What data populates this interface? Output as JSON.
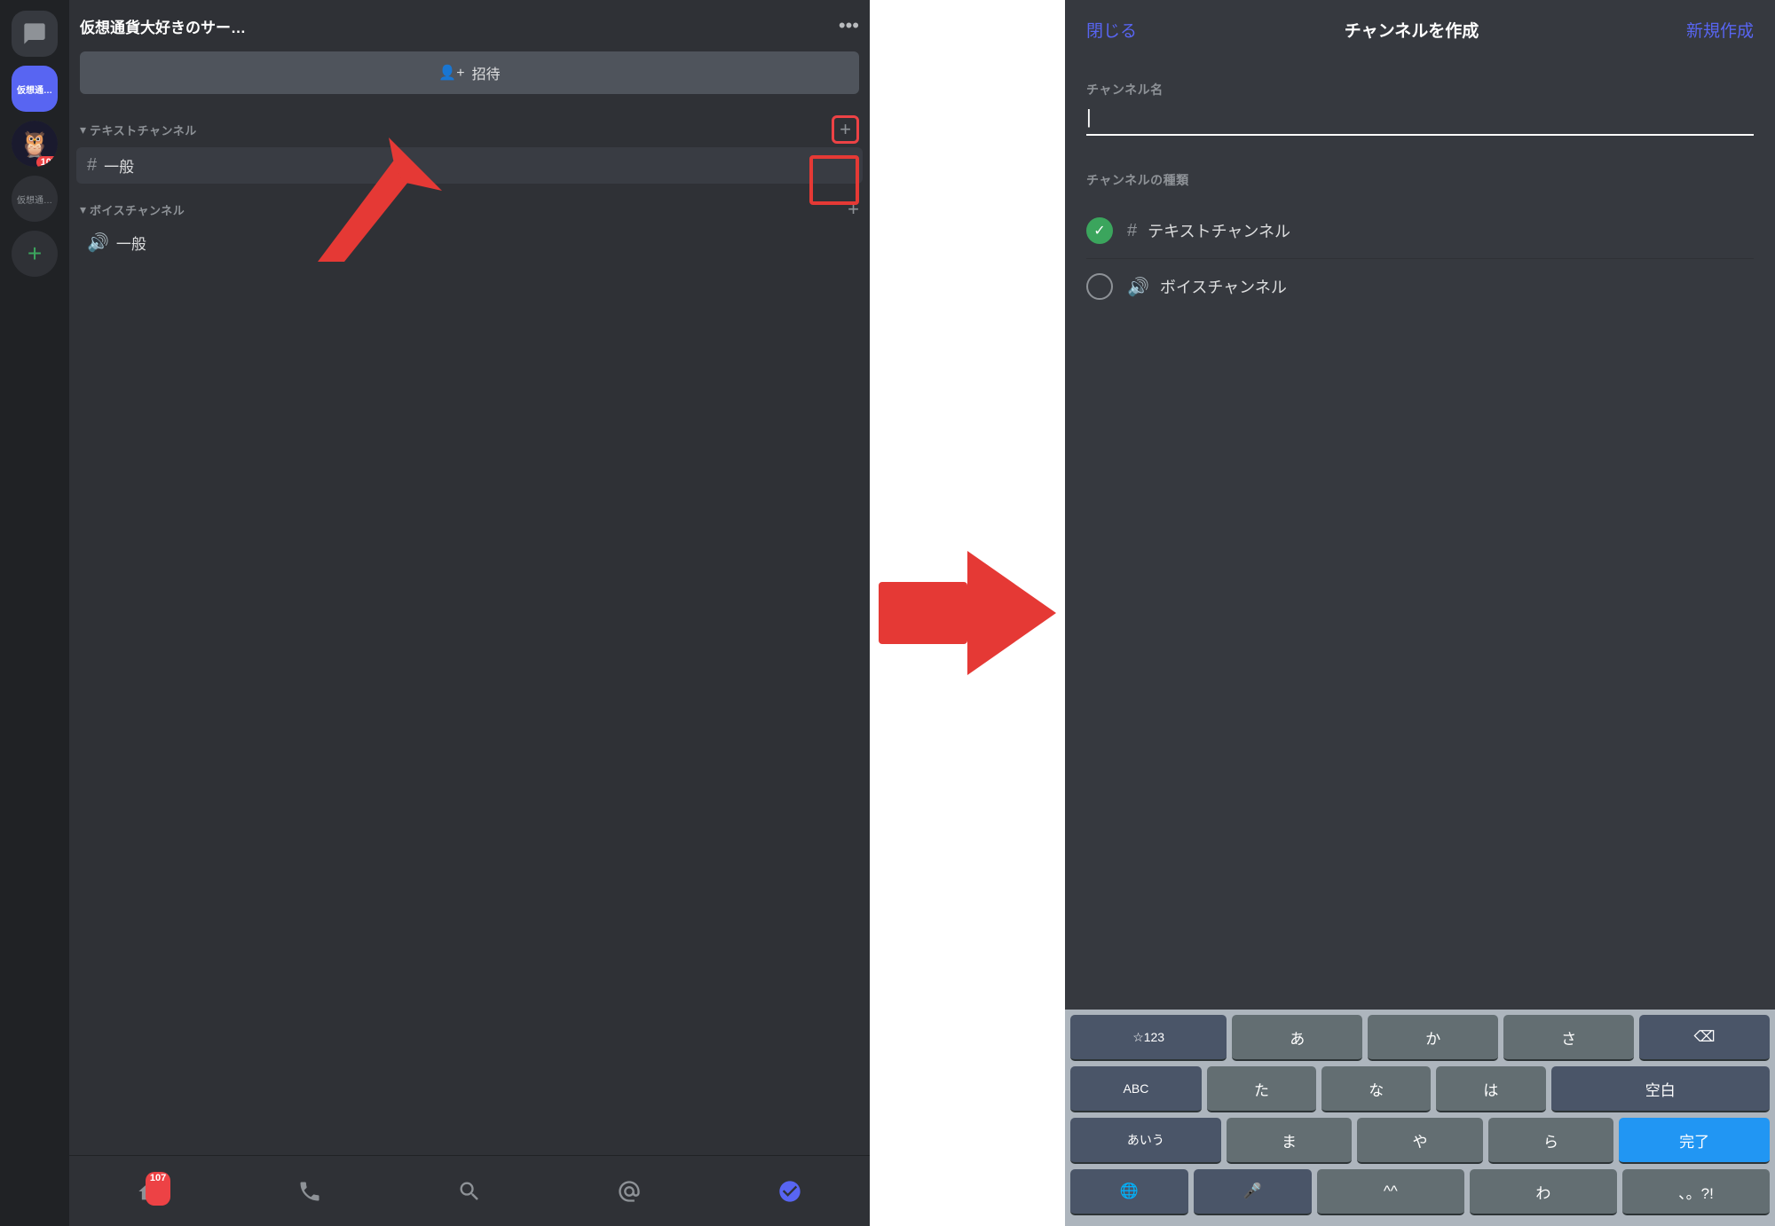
{
  "left": {
    "server_name": "仮想通貨大好きのサー…",
    "more_icon": "•••",
    "invite_label": "招待",
    "text_channel_section": "テキストチャンネル",
    "voice_channel_section": "ボイスチャンネル",
    "general_channel": "一般",
    "voice_general": "一般",
    "badge_count": "107",
    "server1_label": "仮想通…",
    "server2_label": "仮想通…",
    "bottom_badge": "107"
  },
  "modal": {
    "close_label": "閉じる",
    "title": "チャンネルを作成",
    "create_label": "新規作成",
    "channel_name_label": "チャンネル名",
    "channel_type_label": "チャンネルの種類",
    "text_channel_option": "テキストチャンネル",
    "voice_channel_option": "ボイスチャンネル"
  },
  "keyboard": {
    "row1": [
      "☆123",
      "あ",
      "か",
      "さ",
      "⌫"
    ],
    "row2": [
      "ABC",
      "た",
      "な",
      "は",
      "空白"
    ],
    "row3": [
      "あいう",
      "ま",
      "や",
      "ら",
      "完了"
    ],
    "row4": [
      "🌐",
      "🎤",
      "^^",
      "わ",
      "、。?!",
      ""
    ]
  },
  "colors": {
    "accent": "#5865f2",
    "green": "#3ba55d",
    "red": "#ed4245",
    "bg_dark": "#202225",
    "bg_medium": "#2f3136",
    "bg_light": "#36393f",
    "text_primary": "#ffffff",
    "text_secondary": "#dcddde",
    "text_muted": "#8e9297"
  }
}
